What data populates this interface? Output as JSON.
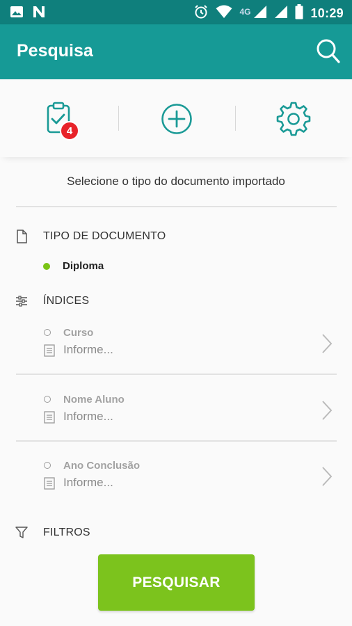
{
  "statusbar": {
    "time": "10:29",
    "network": "4G",
    "icons": [
      "image-icon",
      "n-app-icon",
      "alarm-icon",
      "wifi-icon",
      "signal-icon",
      "signal-icon",
      "battery-icon"
    ]
  },
  "appbar": {
    "title": "Pesquisa",
    "action_icon": "search-icon"
  },
  "actions": {
    "items": [
      {
        "icon": "clipboard-check-icon",
        "badge": "4"
      },
      {
        "icon": "add-circle-icon"
      },
      {
        "icon": "settings-gear-icon"
      }
    ]
  },
  "instruction": "Selecione o tipo do documento importado",
  "document_type": {
    "header": "TIPO DE DOCUMENTO",
    "selected": "Diploma"
  },
  "indices": {
    "header": "ÍNDICES",
    "fields": [
      {
        "name": "Curso",
        "placeholder": "Informe..."
      },
      {
        "name": "Nome Aluno",
        "placeholder": "Informe..."
      },
      {
        "name": "Ano Conclusão",
        "placeholder": "Informe..."
      }
    ]
  },
  "filters": {
    "header": "FILTROS"
  },
  "search_button": {
    "label": "PESQUISAR"
  },
  "colors": {
    "statusbar": "#0f7f7c",
    "appbar": "#169a96",
    "accent_icon": "#1a9a96",
    "badge": "#e8232a",
    "selected_dot": "#7ac415",
    "primary_button": "#7cc31d"
  }
}
